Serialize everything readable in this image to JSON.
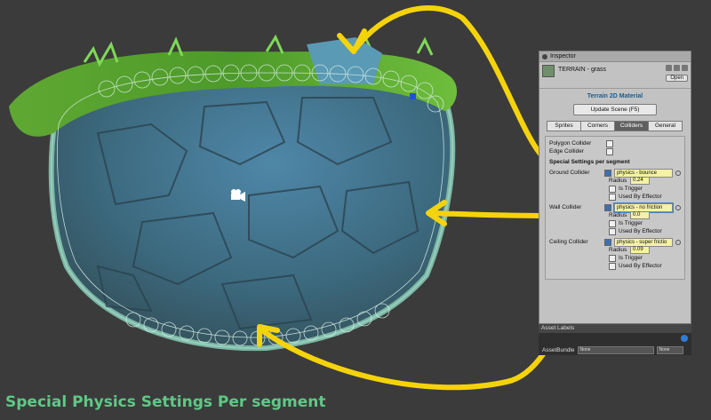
{
  "caption": "Special Physics Settings Per segment",
  "inspector": {
    "tab_label": "Inspector",
    "object_name": "TERRAIN - grass",
    "open_label": "Open",
    "section_title": "Terrain 2D Material",
    "update_button": "Update Scene (F5)",
    "tabs": [
      "Sprites",
      "Corners",
      "Colliders",
      "General"
    ],
    "active_tab": "Colliders",
    "polygon_collider": "Polygon Collider",
    "edge_collider": "Edge Collider",
    "special_title": "Special Settings per segment",
    "ground": {
      "label": "Ground Collider",
      "material": "physics - bounce",
      "radius_label": "Radius",
      "radius": "0.24",
      "trigger": "Is Trigger",
      "effector": "Used By Effector"
    },
    "wall": {
      "label": "Wall Collider",
      "material": "physics - no friction",
      "radius_label": "Radius",
      "radius": "0.0",
      "trigger": "Is Trigger",
      "effector": "Used By Effector"
    },
    "ceiling": {
      "label": "Ceiling Collider",
      "material": "physics - super frictio",
      "radius_label": "Radius",
      "radius": "0.09",
      "trigger": "Is Trigger",
      "effector": "Used By Effector"
    }
  },
  "asset_labels": {
    "title": "Asset Labels",
    "assetbundle_label": "AssetBundle",
    "bundle_value": "None",
    "variant_value": "None"
  },
  "colors": {
    "arrow": "#f5d30b",
    "highlight": "#f4f2a4",
    "caption": "#5fc886"
  }
}
